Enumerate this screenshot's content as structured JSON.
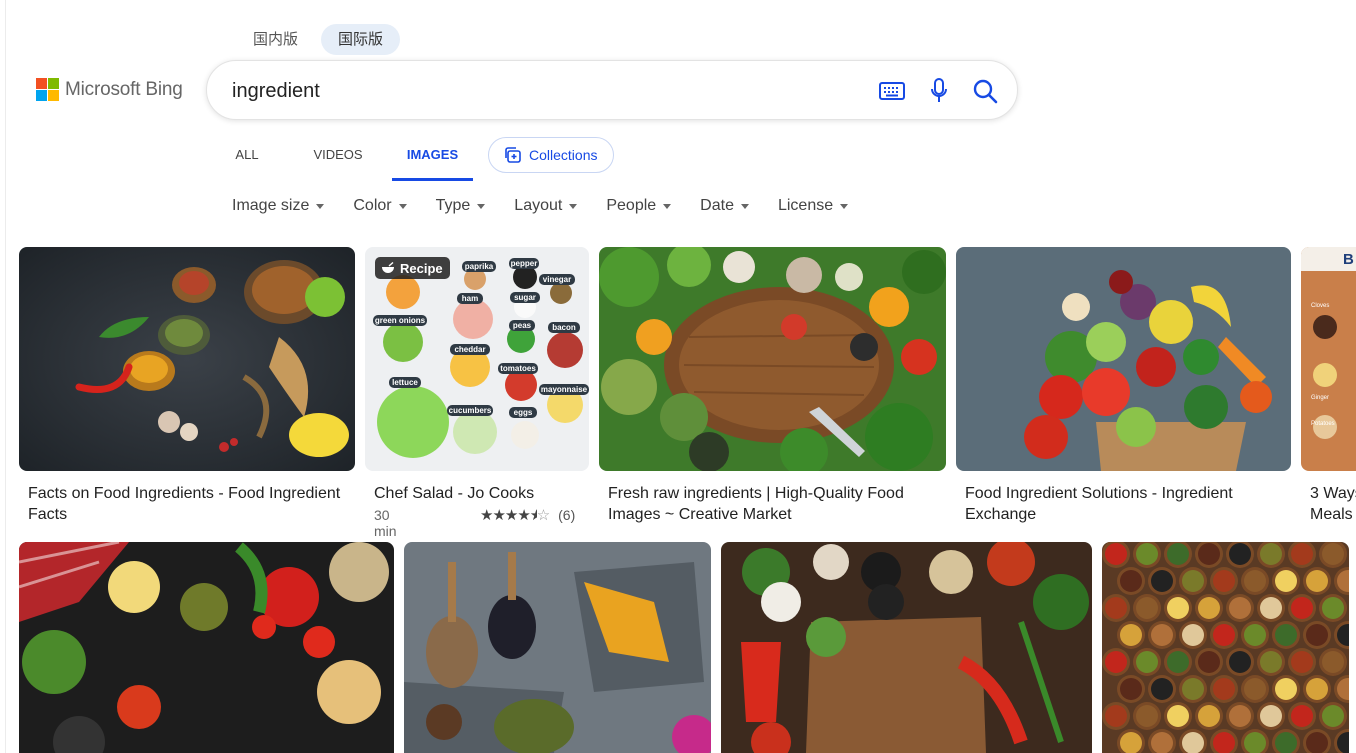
{
  "region_tabs": [
    {
      "label": "国内版",
      "active": false
    },
    {
      "label": "国际版",
      "active": true
    }
  ],
  "logo": {
    "brand": "Microsoft Bing",
    "colors": [
      "#f25022",
      "#7fba00",
      "#00a4ef",
      "#ffb900"
    ]
  },
  "search": {
    "query": "ingredient",
    "icons": [
      "keyboard-icon",
      "microphone-icon",
      "search-icon"
    ]
  },
  "scope_tabs": [
    {
      "label": "ALL",
      "active": false
    },
    {
      "label": "VIDEOS",
      "active": false
    },
    {
      "label": "IMAGES",
      "active": true
    }
  ],
  "collections_label": "Collections",
  "filters": [
    "Image size",
    "Color",
    "Type",
    "Layout",
    "People",
    "Date",
    "License"
  ],
  "accent_color": "#174ae4",
  "results": [
    {
      "caption_line1": "Facts on Food Ingredients - Food Ingredient",
      "caption_line2": "Facts"
    },
    {
      "caption_line1": "Chef Salad - Jo Cooks",
      "badge": "Recipe",
      "time": "30 min",
      "rating_stars": 4.5,
      "rating_count": "(6)",
      "thumb_labels": [
        "paprika",
        "pepper",
        "vinegar",
        "ham",
        "sugar",
        "green onions",
        "cheddar",
        "peas",
        "bacon",
        "lettuce",
        "tomatoes",
        "mayonnaise",
        "cucumbers",
        "eggs"
      ]
    },
    {
      "caption_line1": "Fresh raw ingredients | High-Quality Food",
      "caption_line2": "Images ~ Creative Market"
    },
    {
      "caption_line1": "Food Ingredient Solutions - Ingredient",
      "caption_line2": "Exchange"
    },
    {
      "caption_line1": "3 Ways",
      "caption_line2": "Meals",
      "thumb_labels": [
        "B",
        "Cloves",
        "Ginger",
        "Potatoes"
      ]
    }
  ]
}
